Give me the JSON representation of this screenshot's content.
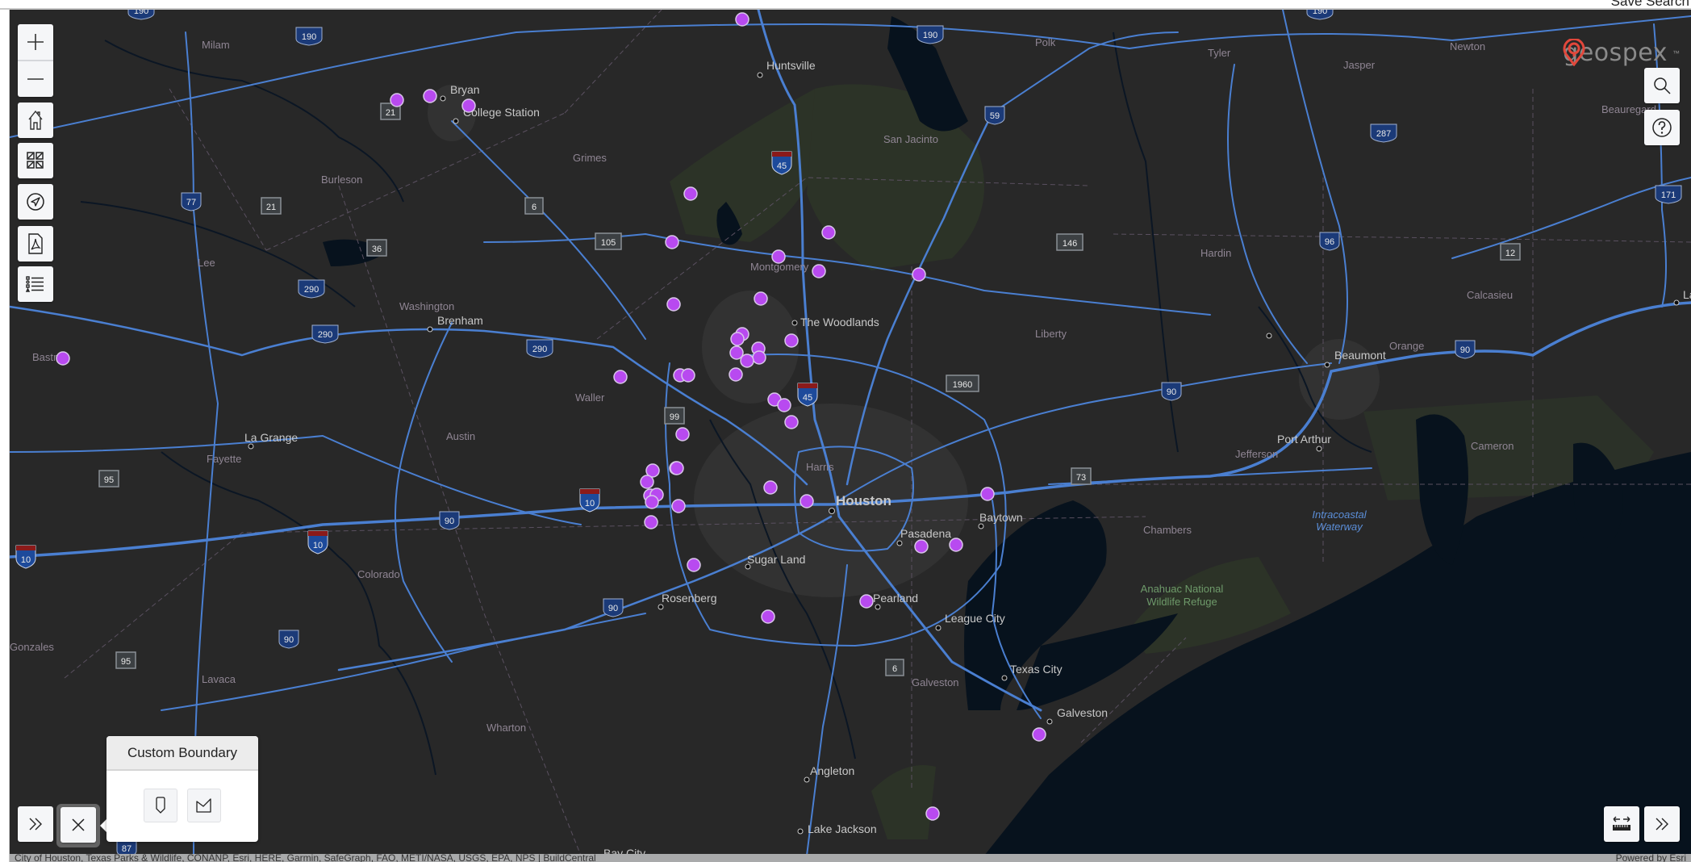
{
  "header": {
    "save_search_label": "Save Search"
  },
  "brand": {
    "name": "geospex",
    "trademark": "™",
    "accent_color": "#e2473b"
  },
  "map_controls": {
    "zoom_in": {
      "icon": "plus-icon",
      "label": "Zoom in"
    },
    "zoom_out": {
      "icon": "minus-icon",
      "label": "Zoom out"
    },
    "home": {
      "icon": "home-icon",
      "label": "Default map view"
    },
    "basemap": {
      "icon": "basemap-gallery-icon",
      "label": "Basemap gallery"
    },
    "locate": {
      "icon": "locate-arrow-icon",
      "label": "Find my location"
    },
    "export_pdf": {
      "icon": "pdf-file-icon",
      "label": "Export PDF"
    },
    "legend": {
      "icon": "legend-list-icon",
      "label": "Legend"
    },
    "search": {
      "icon": "search-icon",
      "label": "Search"
    },
    "help": {
      "icon": "help-icon",
      "label": "Help"
    },
    "expand_left": {
      "icon": "double-chevron-right-icon",
      "label": "Expand"
    },
    "close": {
      "icon": "close-icon",
      "label": "Close"
    },
    "measure": {
      "icon": "measure-ruler-icon",
      "label": "Measure"
    },
    "expand_right": {
      "icon": "double-chevron-right-icon",
      "label": "Expand"
    }
  },
  "custom_boundary_popup": {
    "title": "Custom Boundary",
    "tools": [
      {
        "icon": "draw-polygon-pin-icon",
        "label": "Draw boundary"
      },
      {
        "icon": "draw-freehand-shape-icon",
        "label": "Draw freehand shape"
      }
    ]
  },
  "attribution": {
    "sources": "City of Houston, Texas Parks & Wildlife, CONANP, Esri, HERE, Garmin, SafeGraph, FAO, METI/NASA, USGS, EPA, NPS | BuildCentral",
    "powered_by": "Powered by Esri"
  },
  "colors": {
    "land": "#282828",
    "water": "#07121d",
    "park": "#2c3327",
    "urban": "#313131",
    "road": "#4a7fd1",
    "marker_fill": "#b84af0",
    "marker_stroke": "#d9c6ea",
    "county_label": "#8f8593",
    "city_label": "#c8c8c8",
    "shield_us": "#1b3a78",
    "shield_state": "#3c4043"
  },
  "map_labels": {
    "cities": [
      {
        "name": "Huntsville"
      },
      {
        "name": "Bryan"
      },
      {
        "name": "College Station"
      },
      {
        "name": "Brenham"
      },
      {
        "name": "The Woodlands"
      },
      {
        "name": "Houston"
      },
      {
        "name": "Baytown"
      },
      {
        "name": "Pasadena"
      },
      {
        "name": "Sugar Land"
      },
      {
        "name": "Rosenberg"
      },
      {
        "name": "Pearland"
      },
      {
        "name": "League City"
      },
      {
        "name": "Texas City"
      },
      {
        "name": "Galveston"
      },
      {
        "name": "Angleton"
      },
      {
        "name": "Lake Jackson"
      },
      {
        "name": "Bay City"
      },
      {
        "name": "Beaumont"
      },
      {
        "name": "Port Arthur"
      },
      {
        "name": "La Grange"
      },
      {
        "name": "Lake Charles"
      }
    ],
    "counties": [
      {
        "name": "Milam"
      },
      {
        "name": "Burleson"
      },
      {
        "name": "Grimes"
      },
      {
        "name": "Lee"
      },
      {
        "name": "Washington"
      },
      {
        "name": "Bastrop"
      },
      {
        "name": "Waller"
      },
      {
        "name": "Austin"
      },
      {
        "name": "Fayette"
      },
      {
        "name": "Colorado"
      },
      {
        "name": "Lavaca"
      },
      {
        "name": "Wharton"
      },
      {
        "name": "Harris"
      },
      {
        "name": "Montgomery"
      },
      {
        "name": "San Jacinto"
      },
      {
        "name": "Polk"
      },
      {
        "name": "Tyler"
      },
      {
        "name": "Jasper"
      },
      {
        "name": "Newton"
      },
      {
        "name": "Beauregard"
      },
      {
        "name": "Hardin"
      },
      {
        "name": "Liberty"
      },
      {
        "name": "Orange"
      },
      {
        "name": "Calcasieu"
      },
      {
        "name": "Jefferson"
      },
      {
        "name": "Cameron"
      },
      {
        "name": "Chambers"
      },
      {
        "name": "Galveston"
      },
      {
        "name": "Gonzales"
      }
    ],
    "features": [
      {
        "name": "Intracoastal Waterway",
        "kind": "water"
      },
      {
        "name": "Anahuac National Wildlife Refuge",
        "kind": "park"
      }
    ],
    "shields": [
      {
        "route": "190",
        "type": "us"
      },
      {
        "route": "190",
        "type": "us"
      },
      {
        "route": "190",
        "type": "us"
      },
      {
        "route": "190",
        "type": "us"
      },
      {
        "route": "21",
        "type": "state"
      },
      {
        "route": "21",
        "type": "state"
      },
      {
        "route": "77",
        "type": "us"
      },
      {
        "route": "6",
        "type": "state"
      },
      {
        "route": "36",
        "type": "state"
      },
      {
        "route": "105",
        "type": "state"
      },
      {
        "route": "45",
        "type": "interstate"
      },
      {
        "route": "45",
        "type": "interstate"
      },
      {
        "route": "59",
        "type": "us"
      },
      {
        "route": "287",
        "type": "us"
      },
      {
        "route": "146",
        "type": "state"
      },
      {
        "route": "96",
        "type": "us"
      },
      {
        "route": "12",
        "type": "state"
      },
      {
        "route": "171",
        "type": "us"
      },
      {
        "route": "290",
        "type": "us"
      },
      {
        "route": "290",
        "type": "us"
      },
      {
        "route": "290",
        "type": "us"
      },
      {
        "route": "1960",
        "type": "state"
      },
      {
        "route": "99",
        "type": "state"
      },
      {
        "route": "90",
        "type": "us"
      },
      {
        "route": "90",
        "type": "us"
      },
      {
        "route": "90",
        "type": "us"
      },
      {
        "route": "90",
        "type": "us"
      },
      {
        "route": "90",
        "type": "us"
      },
      {
        "route": "10",
        "type": "interstate"
      },
      {
        "route": "10",
        "type": "interstate"
      },
      {
        "route": "10",
        "type": "interstate"
      },
      {
        "route": "73",
        "type": "state"
      },
      {
        "route": "95",
        "type": "state"
      },
      {
        "route": "95",
        "type": "state"
      },
      {
        "route": "6",
        "type": "state"
      },
      {
        "route": "87",
        "type": "us"
      }
    ]
  },
  "property_markers": {
    "count": 47
  }
}
